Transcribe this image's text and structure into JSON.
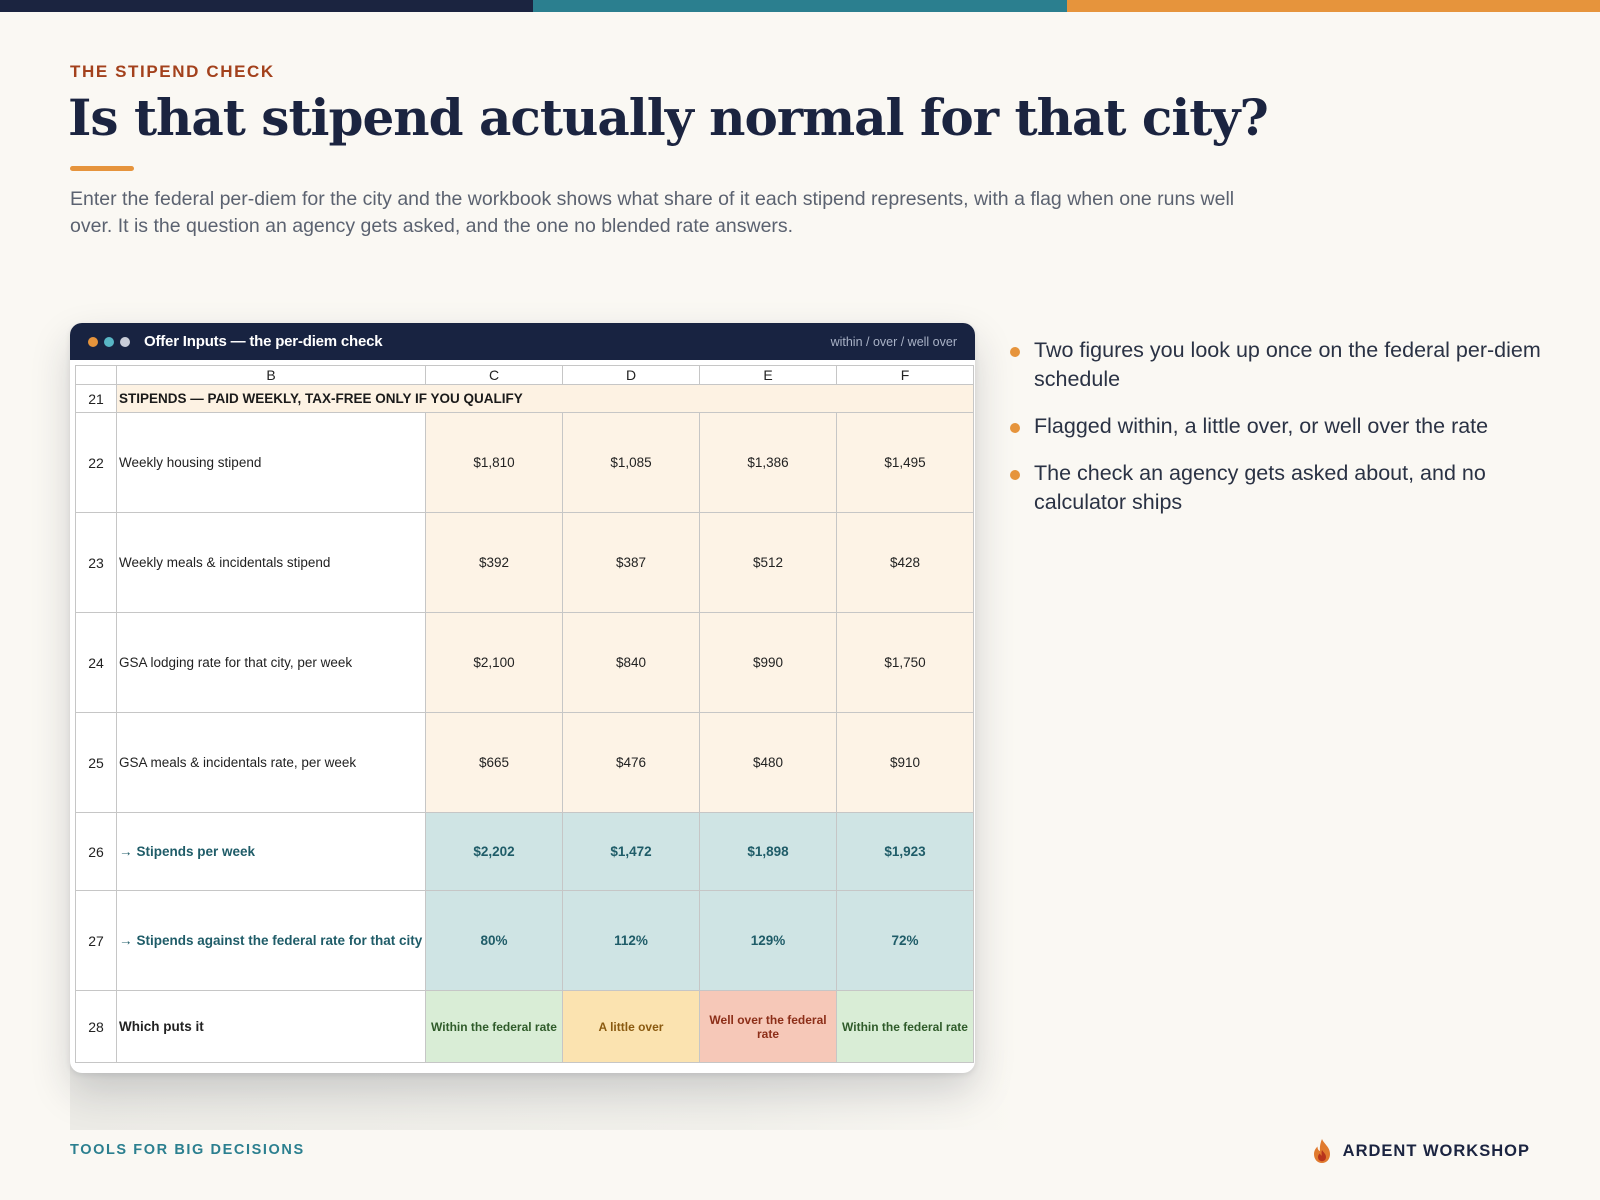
{
  "brand_colors": {
    "navy": "#1b2440",
    "teal": "#2b7f8f",
    "orange": "#e6943c",
    "rust": "#a3411c"
  },
  "header": {
    "eyebrow": "THE STIPEND CHECK",
    "title": "Is that stipend actually normal for that city?",
    "subtitle": "Enter the federal per-diem for the city and the workbook shows what share of it each stipend represents, with a flag when one runs well over. It is the question an agency gets asked, and the one no blended rate answers."
  },
  "window": {
    "title": "Offer Inputs — the per-diem check",
    "meta": "within / over / well over",
    "dot_colors": [
      "#e6943c",
      "#58b6c5",
      "#c9cdd8"
    ]
  },
  "sheet": {
    "columns": [
      "B",
      "C",
      "D",
      "E",
      "F"
    ],
    "section_row": {
      "num": "21",
      "label": "STIPENDS — PAID WEEKLY, TAX-FREE ONLY IF YOU QUALIFY"
    },
    "rows": [
      {
        "num": "22",
        "label": "Weekly housing stipend",
        "values": [
          "$1,810",
          "$1,085",
          "$1,386",
          "$1,495"
        ]
      },
      {
        "num": "23",
        "label": "Weekly meals & incidentals stipend",
        "values": [
          "$392",
          "$387",
          "$512",
          "$428"
        ]
      },
      {
        "num": "24",
        "label": "GSA lodging rate for that city, per week",
        "values": [
          "$2,100",
          "$840",
          "$990",
          "$1,750"
        ]
      },
      {
        "num": "25",
        "label": "GSA meals & incidentals rate, per week",
        "values": [
          "$665",
          "$476",
          "$480",
          "$910"
        ]
      },
      {
        "num": "26",
        "label": "Stipends per week",
        "values": [
          "$2,202",
          "$1,472",
          "$1,898",
          "$1,923"
        ]
      },
      {
        "num": "27",
        "label": "Stipends against the federal rate for that city",
        "values": [
          "80%",
          "112%",
          "129%",
          "72%"
        ]
      },
      {
        "num": "28",
        "label": "Which puts it",
        "values": [
          "Within the federal rate",
          "A little over",
          "Well over the federal rate",
          "Within the federal rate"
        ]
      }
    ]
  },
  "bullets": [
    "Two figures you look up once on the federal per-diem schedule",
    "Flagged within, a little over, or well over the rate",
    "The check an agency gets asked about, and no calculator ships"
  ],
  "footer": {
    "left": "TOOLS FOR BIG DECISIONS",
    "brand": "ARDENT WORKSHOP"
  }
}
